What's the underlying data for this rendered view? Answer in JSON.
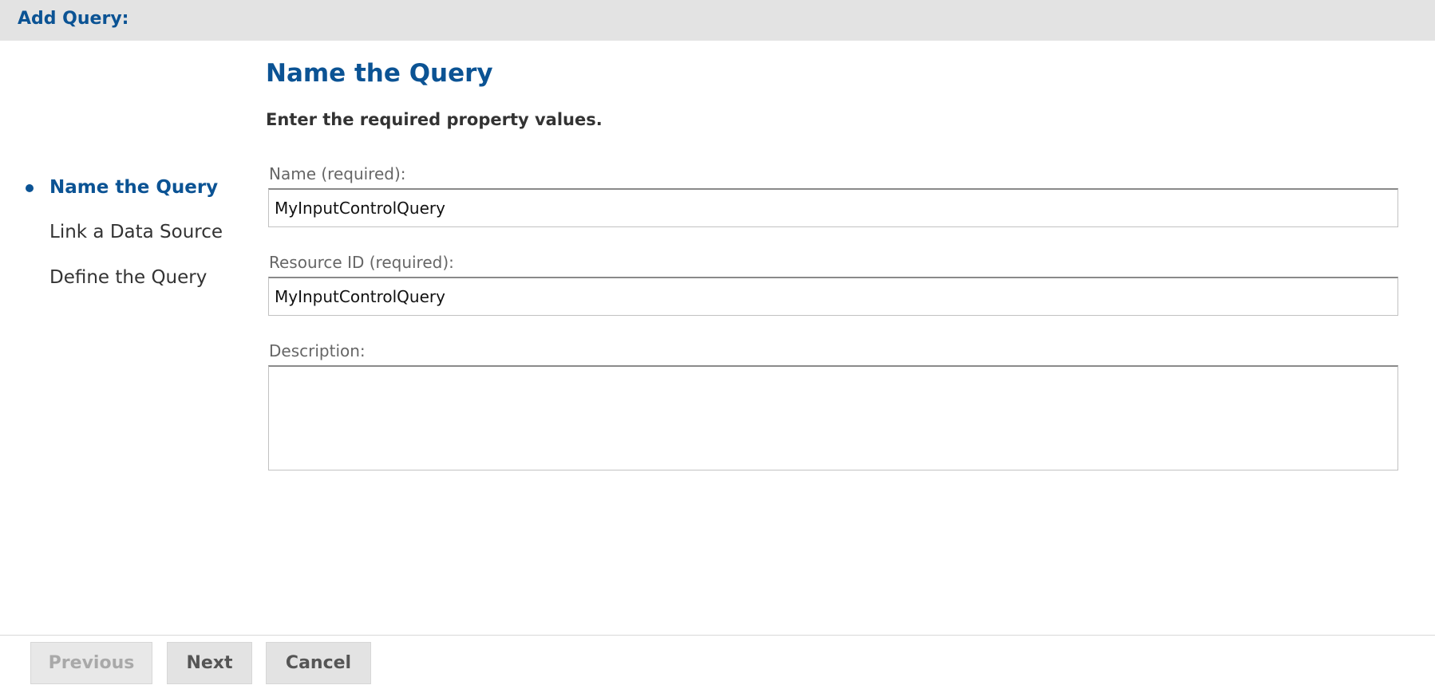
{
  "header": {
    "title": "Add Query:"
  },
  "steps": {
    "items": [
      {
        "label": "Name the Query",
        "active": true
      },
      {
        "label": "Link a Data Source",
        "active": false
      },
      {
        "label": "Define the Query",
        "active": false
      }
    ]
  },
  "main": {
    "title": "Name the Query",
    "instructions": "Enter the required property values.",
    "fields": {
      "name": {
        "label": "Name (required):",
        "value": "MyInputControlQuery"
      },
      "resource_id": {
        "label": "Resource ID (required):",
        "value": "MyInputControlQuery"
      },
      "description": {
        "label": "Description:",
        "value": ""
      }
    }
  },
  "footer": {
    "previous_label": "Previous",
    "next_label": "Next",
    "cancel_label": "Cancel"
  },
  "colors": {
    "accent": "#0b5394",
    "header_bg": "#e3e3e3",
    "button_bg": "#e3e3e3",
    "disabled_text": "#a9a9a9"
  }
}
